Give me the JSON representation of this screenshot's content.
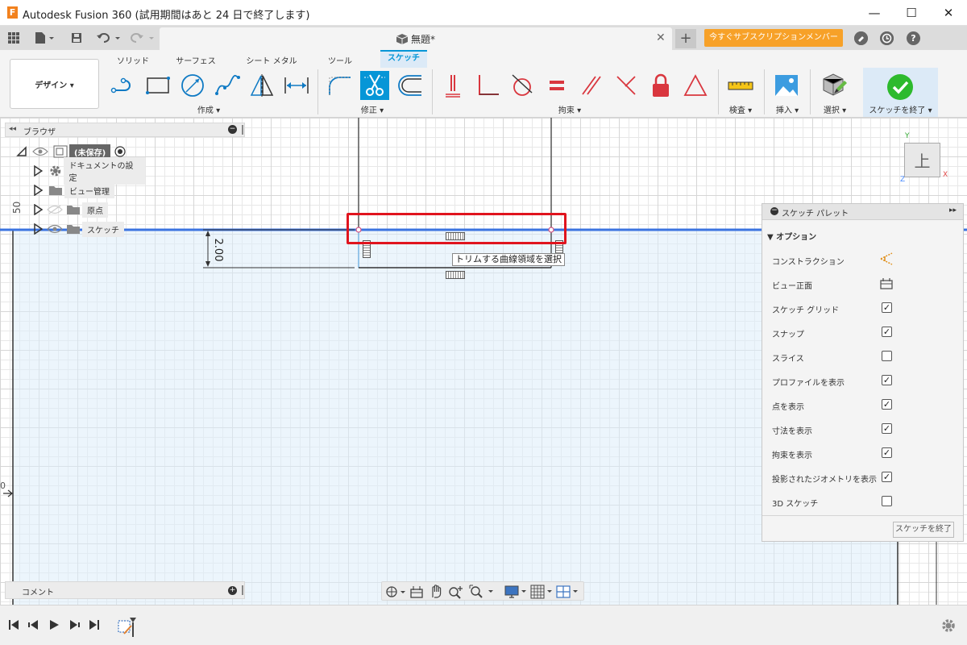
{
  "window": {
    "title": "Autodesk Fusion 360 (試用期間はあと 24 日で終了します)",
    "logo": "F",
    "min": "—",
    "max": "☐",
    "close": "✕"
  },
  "tabbar": {
    "doc_title": "無題*",
    "close": "✕",
    "new_tab": "+",
    "subscribe": "今すぐサブスクリプションメンバーに..."
  },
  "toolbar": {
    "workspace": "デザイン ▾",
    "tabs": [
      "ソリッド",
      "サーフェス",
      "シート メタル",
      "ツール",
      "スケッチ"
    ],
    "groups": {
      "create": "作成 ▾",
      "modify": "修正 ▾",
      "constraints": "拘束 ▾",
      "inspect": "検査 ▾",
      "insert": "挿入 ▾",
      "select": "選択 ▾",
      "finish": "スケッチを終了 ▾"
    }
  },
  "browser": {
    "title": "ブラウザ",
    "items": [
      {
        "label": "(未保存)"
      },
      {
        "label": "ドキュメントの設定"
      },
      {
        "label": "ビュー管理"
      },
      {
        "label": "原点"
      },
      {
        "label": "スケッチ"
      }
    ]
  },
  "comments": {
    "label": "コメント"
  },
  "canvas": {
    "ruler_value": "50",
    "dimension": "2.00",
    "tooltip": "トリムする曲線領域を選択",
    "left_tick": "0"
  },
  "viewcube": {
    "face": "上",
    "axis_x": "X",
    "axis_y": "Y",
    "axis_z": "Z"
  },
  "palette": {
    "title": "スケッチ パレット",
    "section": "オプション",
    "rows": [
      {
        "label": "コンストラクション",
        "kind": "icon"
      },
      {
        "label": "ビュー正面",
        "kind": "icon"
      },
      {
        "label": "スケッチ グリッド",
        "checked": true
      },
      {
        "label": "スナップ",
        "checked": true
      },
      {
        "label": "スライス",
        "checked": false
      },
      {
        "label": "プロファイルを表示",
        "checked": true
      },
      {
        "label": "点を表示",
        "checked": true
      },
      {
        "label": "寸法を表示",
        "checked": true
      },
      {
        "label": "拘束を表示",
        "checked": true
      },
      {
        "label": "投影されたジオメトリを表示",
        "checked": true
      },
      {
        "label": "3D スケッチ",
        "checked": false
      }
    ],
    "finish": "スケッチを終了"
  },
  "colors": {
    "accent": "#0696d7",
    "highlight": "#e0141e",
    "orange": "#f7a128",
    "red_tool": "#d9363e"
  }
}
